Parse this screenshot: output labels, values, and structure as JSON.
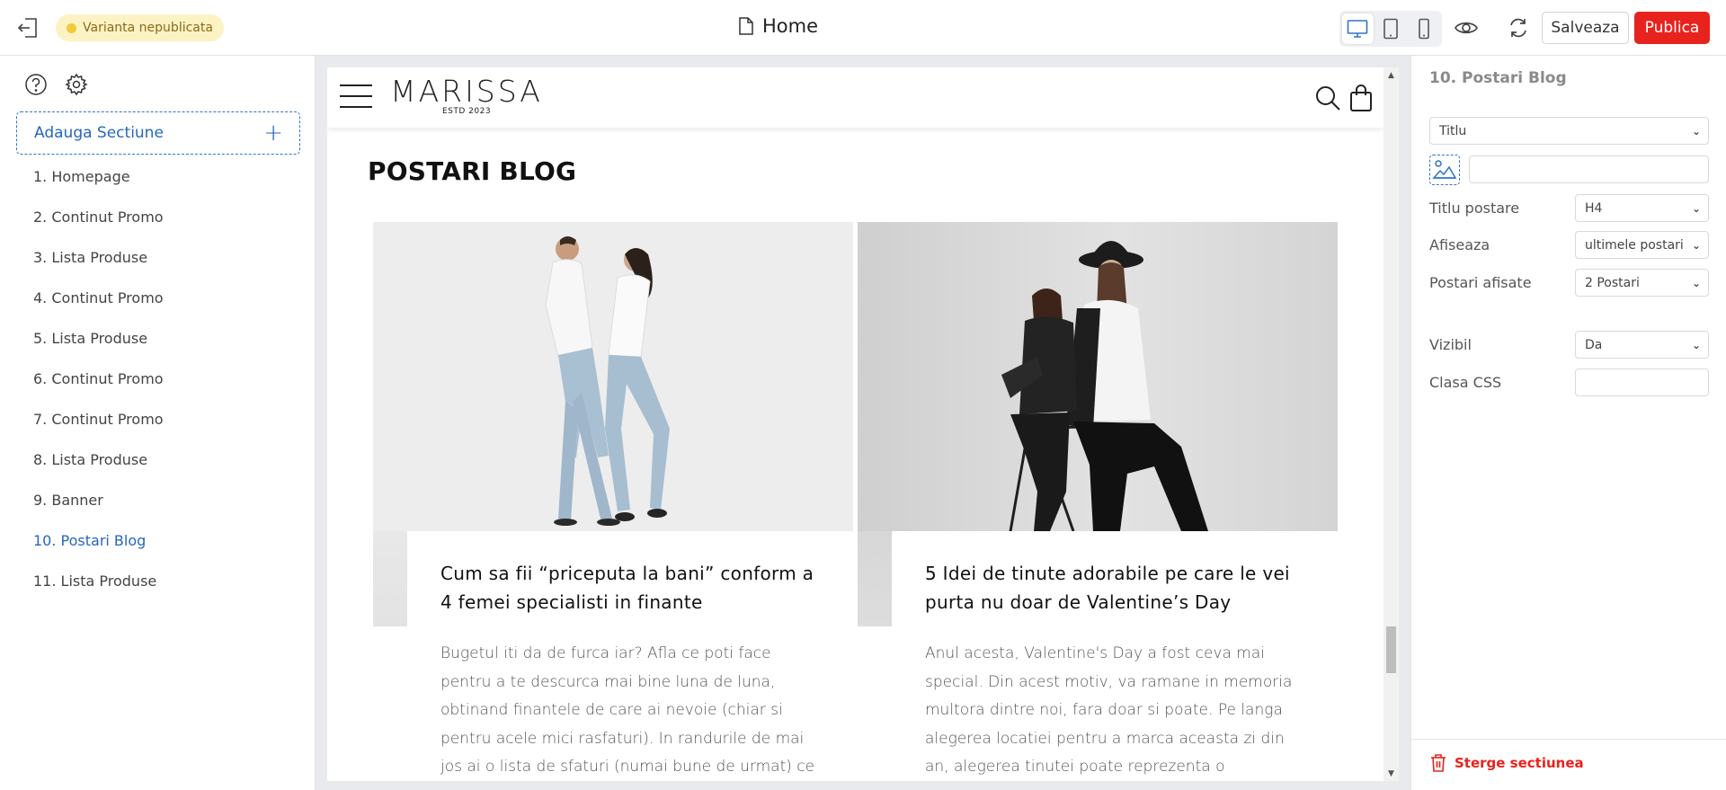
{
  "topbar": {
    "variant_badge": "Varianta nepublicata",
    "page_title": "Home",
    "save_label": "Salveaza",
    "publish_label": "Publica",
    "devices": [
      "desktop",
      "tablet",
      "mobile"
    ],
    "active_device": "desktop"
  },
  "sidebar": {
    "add_section_label": "Adauga Sectiune",
    "sections": [
      "1. Homepage",
      "2. Continut Promo",
      "3. Lista Produse",
      "4. Continut Promo",
      "5. Lista Produse",
      "6. Continut Promo",
      "7. Continut Promo",
      "8. Lista Produse",
      "9. Banner",
      "10. Postari Blog",
      "11. Lista Produse"
    ],
    "active_section": "10. Postari Blog"
  },
  "preview": {
    "logo": "MARISSA",
    "logo_sub": "ESTD 2023",
    "blog_heading": "POSTARI BLOG",
    "posts": [
      {
        "title": "Cum sa fii “priceputa la bani” conform a 4 femei specialisti in finante",
        "excerpt": "Bugetul iti da de furca iar? Afla ce poti face pentru a te descurca mai bine luna de luna, obtinand finantele de care ai nevoie (chiar si pentru acele mici rasfaturi). In randurile de mai jos ai o lista de sfaturi (numai bune de urmat) ce te vor ajuta sa"
      },
      {
        "title": "5 Idei de tinute adorabile pe care le vei purta nu doar de Valentine’s Day",
        "excerpt": "Anul acesta, Valentine's Day a fost ceva mai special. Din acest motiv, va ramane in memoria multora dintre noi, fara doar si poate. Pe langa alegerea locatiei pentru a marca aceasta zi din an, alegerea tinutei poate reprezenta o adevarata"
      }
    ]
  },
  "panel": {
    "title": "10. Postari Blog",
    "heading_type": "Titlu",
    "heading_text": "",
    "fields": {
      "post_title_label": "Titlu postare",
      "post_title_value": "H4",
      "show_label": "Afiseaza",
      "show_value": "ultimele postari",
      "posts_shown_label": "Postari afisate",
      "posts_shown_value": "2 Postari",
      "visible_label": "Vizibil",
      "visible_value": "Da",
      "css_label": "Clasa CSS",
      "css_value": ""
    },
    "delete_label": "Sterge sectiunea"
  },
  "colors": {
    "accent_blue": "#2567bb",
    "publish_red": "#e8231d",
    "badge_bg": "#fdf2c4"
  }
}
